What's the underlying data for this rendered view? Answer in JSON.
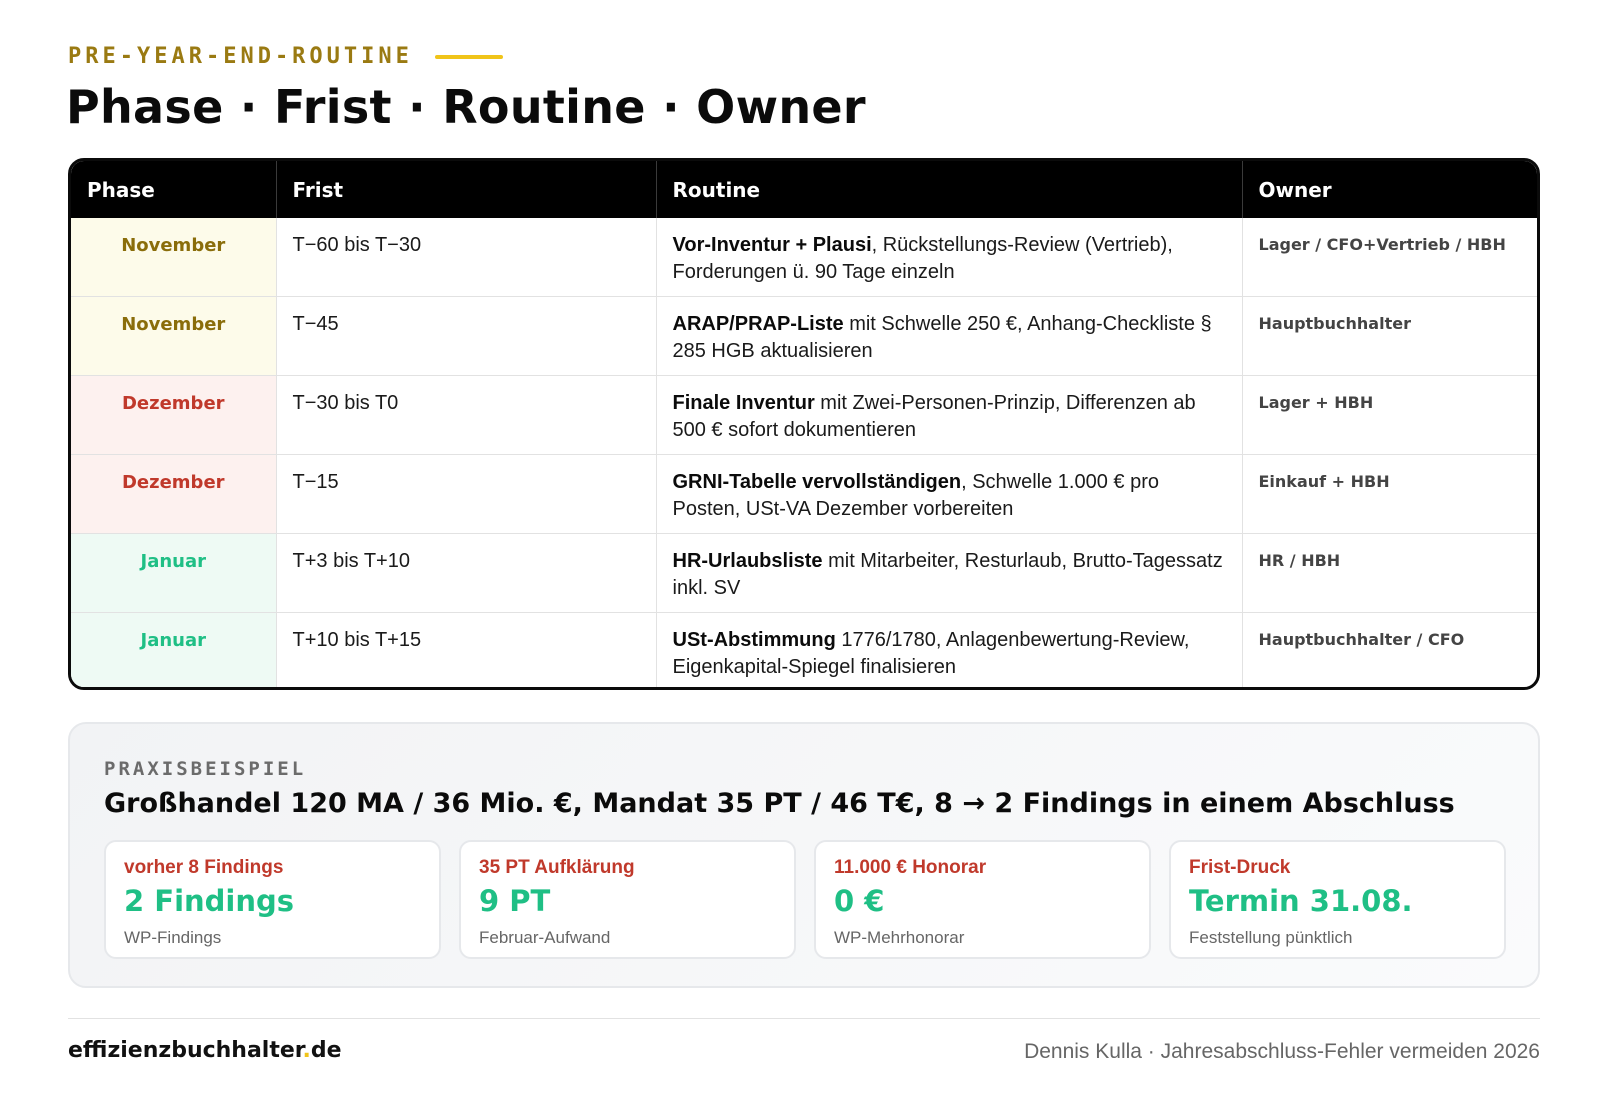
{
  "header": {
    "eyebrow": "PRE-YEAR-END-ROUTINE",
    "title": "Phase · Frist · Routine · Owner"
  },
  "table": {
    "columns": [
      "Phase",
      "Frist",
      "Routine",
      "Owner"
    ],
    "rows": [
      {
        "phase": "November",
        "frist": "T−60 bis T−30",
        "routine_bold": "Vor-Inventur + Plausi",
        "routine_rest": ", Rückstellungs-Review (Vertrieb), Forderungen ü. 90 Tage einzeln",
        "owner": "Lager / CFO+Vertrieb / HBH"
      },
      {
        "phase": "November",
        "frist": "T−45",
        "routine_bold": "ARAP/PRAP-Liste",
        "routine_rest": " mit Schwelle 250 €, Anhang-Checkliste § 285 HGB aktualisieren",
        "owner": "Hauptbuchhalter"
      },
      {
        "phase": "Dezember",
        "frist": "T−30 bis T0",
        "routine_bold": "Finale Inventur",
        "routine_rest": " mit Zwei-Personen-Prinzip, Differenzen ab 500 € sofort dokumentieren",
        "owner": "Lager + HBH"
      },
      {
        "phase": "Dezember",
        "frist": "T−15",
        "routine_bold": "GRNI-Tabelle vervollständigen",
        "routine_rest": ", Schwelle 1.000 € pro Posten, USt-VA Dezember vorbereiten",
        "owner": "Einkauf + HBH"
      },
      {
        "phase": "Januar",
        "frist": "T+3 bis T+10",
        "routine_bold": "HR-Urlaubsliste",
        "routine_rest": " mit Mitarbeiter, Resturlaub, Brutto-Tagessatz inkl. SV",
        "owner": "HR / HBH"
      },
      {
        "phase": "Januar",
        "frist": "T+10 bis T+15",
        "routine_bold": "USt-Abstimmung",
        "routine_rest": " 1776/1780, Anlagenbewertung-Review, Eigenkapital-Spiegel finalisieren",
        "owner": "Hauptbuchhalter / CFO"
      }
    ]
  },
  "phase_colors": {
    "November": {
      "text": "#8a6d0a",
      "bg": "#fdfbea"
    },
    "Dezember": {
      "text": "#c0392b",
      "bg": "#fdf1ef"
    },
    "Januar": {
      "text": "#1fbf85",
      "bg": "#eefaf4"
    }
  },
  "praxis": {
    "label": "PRAXISBEISPIEL",
    "title": "Großhandel 120 MA / 36 Mio. €, Mandat 35 PT / 46 T€, 8 → 2 Findings in einem Abschluss",
    "cards": [
      {
        "top": "vorher 8 Findings",
        "main": "2 Findings",
        "sub": "WP-Findings"
      },
      {
        "top": "35 PT Aufklärung",
        "main": "9 PT",
        "sub": "Februar-Aufwand"
      },
      {
        "top": "11.000 € Honorar",
        "main": "0 €",
        "sub": "WP-Mehrhonorar"
      },
      {
        "top": "Frist-Druck",
        "main": "Termin 31.08.",
        "sub": "Feststellung pünktlich"
      }
    ]
  },
  "footer": {
    "brand_name": "effizienzbuchhalter",
    "brand_dot": ".",
    "brand_tld": "de",
    "credit": "Dennis Kulla · Jahresabschluss-Fehler vermeiden 2026"
  }
}
